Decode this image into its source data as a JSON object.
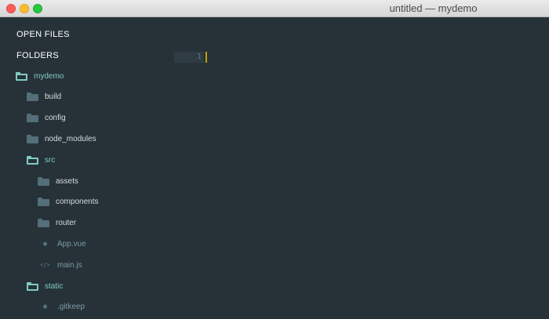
{
  "window": {
    "title": "untitled — mydemo"
  },
  "sidebar": {
    "open_files_label": "OPEN FILES",
    "folders_label": "FOLDERS",
    "tree": [
      {
        "label": "mydemo",
        "kind": "folder",
        "open": true,
        "depth": 0
      },
      {
        "label": "build",
        "kind": "folder",
        "open": false,
        "depth": 1
      },
      {
        "label": "config",
        "kind": "folder",
        "open": false,
        "depth": 1
      },
      {
        "label": "node_modules",
        "kind": "folder",
        "open": false,
        "depth": 1
      },
      {
        "label": "src",
        "kind": "folder",
        "open": true,
        "depth": 1
      },
      {
        "label": "assets",
        "kind": "folder",
        "open": false,
        "depth": 2
      },
      {
        "label": "components",
        "kind": "folder",
        "open": false,
        "depth": 2
      },
      {
        "label": "router",
        "kind": "folder",
        "open": false,
        "depth": 2
      },
      {
        "label": "App.vue",
        "kind": "file",
        "icon": "asterisk-icon",
        "depth": 2
      },
      {
        "label": "main.js",
        "kind": "file",
        "icon": "code-icon",
        "depth": 2
      },
      {
        "label": "static",
        "kind": "folder",
        "open": true,
        "depth": 1
      },
      {
        "label": ".gitkeep",
        "kind": "file",
        "icon": "asterisk-icon",
        "depth": 2
      }
    ]
  },
  "editor": {
    "line_number": "1"
  },
  "icons": {
    "nav_back": "chevron-left-icon",
    "nav_forward": "chevron-right-icon"
  },
  "colors": {
    "background": "#263238",
    "open_folder_accent": "#80cbc4",
    "closed_folder": "#546e7a",
    "caret": "#c0a000"
  }
}
